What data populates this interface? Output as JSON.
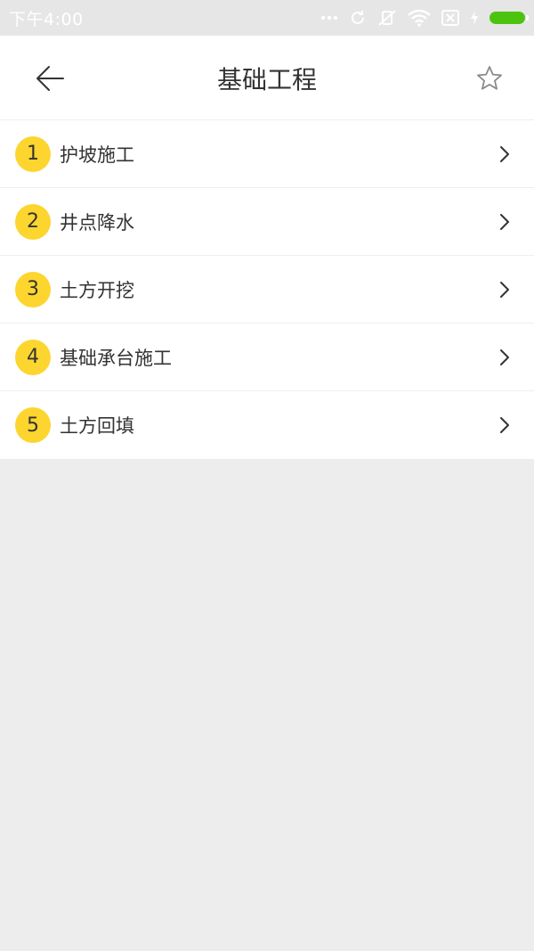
{
  "status_bar": {
    "time": "下午4:00",
    "battery_color": "#4cc40f"
  },
  "header": {
    "title": "基础工程",
    "back_icon": "back-arrow-icon",
    "favorite_icon": "star-outline-icon"
  },
  "list": {
    "badge_color": "#fdd52f",
    "items": [
      {
        "number": "1",
        "label": "护坡施工"
      },
      {
        "number": "2",
        "label": "井点降水"
      },
      {
        "number": "3",
        "label": "土方开挖"
      },
      {
        "number": "4",
        "label": "基础承台施工"
      },
      {
        "number": "5",
        "label": "土方回填"
      }
    ]
  }
}
